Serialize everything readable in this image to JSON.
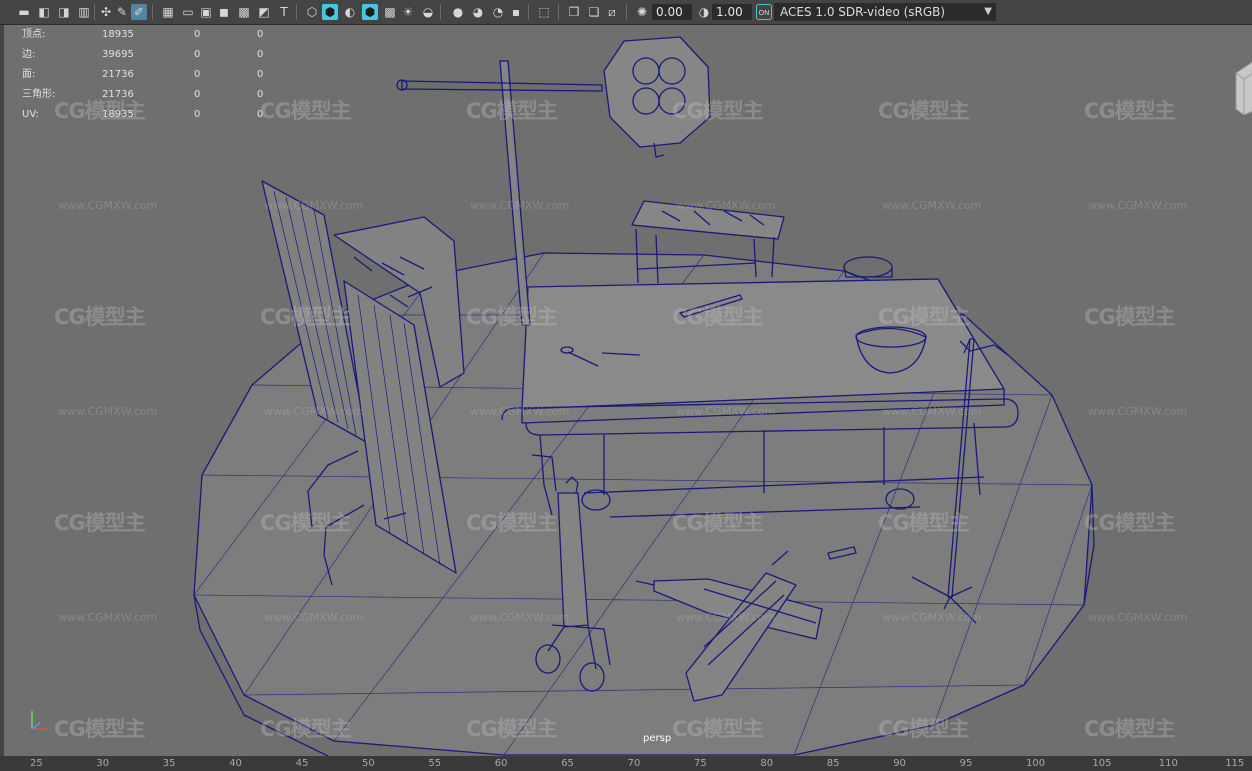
{
  "toolbar": {
    "exposure_value": "0.00",
    "gamma_value": "1.00",
    "color_management_badge": "ON",
    "color_space": "ACES 1.0 SDR-video (sRGB)",
    "icons": [
      "camera-icon",
      "camera-attr-icon",
      "bookmark-icon",
      "image-plane-icon",
      "2d-pan-icon",
      "grease-pencil-icon",
      "grid-icon",
      "film-gate-icon",
      "resolution-gate-icon",
      "gate-mask-icon",
      "field-chart-icon",
      "safe-action-icon",
      "safe-title-icon",
      "wireframe-icon",
      "smooth-shade-icon",
      "default-lighting-icon",
      "wireframe-on-shaded-icon",
      "textured-icon",
      "use-all-lights-icon",
      "shadows-icon",
      "ambient-occlusion-icon",
      "motion-blur-icon",
      "anti-alias-icon",
      "depth-of-field-icon",
      "isolate-select-icon",
      "xray-icon",
      "xray-joints-icon",
      "xray-active-icon",
      "exposure-icon",
      "gamma-icon",
      "color-management-icon"
    ]
  },
  "hud": {
    "rows": [
      {
        "label": "顶点:",
        "v1": "18935",
        "v2": "0",
        "v3": "0"
      },
      {
        "label": "边:",
        "v1": "39695",
        "v2": "0",
        "v3": "0"
      },
      {
        "label": "面:",
        "v1": "21736",
        "v2": "0",
        "v3": "0"
      },
      {
        "label": "三角形:",
        "v1": "21736",
        "v2": "0",
        "v3": "0"
      },
      {
        "label": "UV:",
        "v1": "18935",
        "v2": "0",
        "v3": "0"
      }
    ]
  },
  "viewport": {
    "camera_label": "persp",
    "watermark_text": "CG模型主",
    "watermark_url": "www.CGMXW.com",
    "background": "#6f6f6f",
    "wire_color": "#1a1a78"
  },
  "timeline": {
    "ticks": [
      "25",
      "30",
      "35",
      "40",
      "45",
      "50",
      "55",
      "60",
      "65",
      "70",
      "75",
      "80",
      "85",
      "90",
      "95",
      "100",
      "105",
      "110",
      "115"
    ]
  }
}
